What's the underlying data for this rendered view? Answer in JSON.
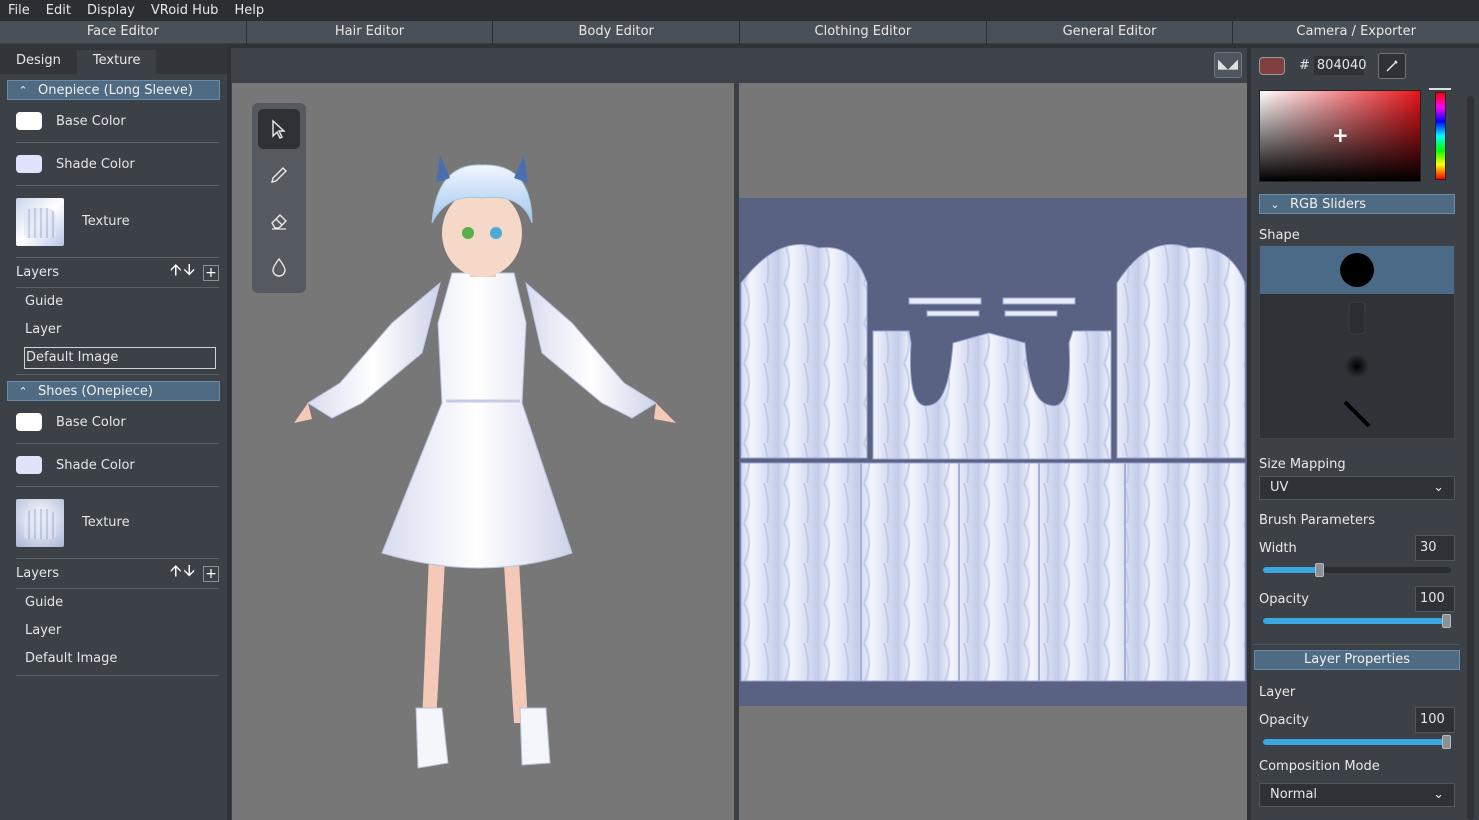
{
  "menu": [
    "File",
    "Edit",
    "Display",
    "VRoid Hub",
    "Help"
  ],
  "editor_tabs": [
    "Face Editor",
    "Hair Editor",
    "Body Editor",
    "Clothing Editor",
    "General Editor",
    "Camera / Exporter"
  ],
  "left": {
    "subtabs": [
      "Design",
      "Texture"
    ],
    "active_subtab": "Texture",
    "sections": [
      {
        "title": "Onepiece (Long Sleeve)",
        "base_color_label": "Base Color",
        "shade_color_label": "Shade Color",
        "texture_label": "Texture",
        "layers_label": "Layers",
        "layers": [
          "Guide",
          "Layer",
          "Default Image"
        ],
        "selected_layer": "Default Image"
      },
      {
        "title": "Shoes (Onepiece)",
        "base_color_label": "Base Color",
        "shade_color_label": "Shade Color",
        "texture_label": "Texture",
        "layers_label": "Layers",
        "layers": [
          "Guide",
          "Layer",
          "Default Image"
        ]
      }
    ],
    "colors": {
      "base": "#ffffff",
      "shade": "#dfe3fb"
    }
  },
  "tools": [
    "pointer-icon",
    "pencil-icon",
    "eraser-icon",
    "bucket-icon"
  ],
  "right": {
    "current_color": "#804040",
    "hex_prefix": "#",
    "hex_value": "804040",
    "rgb_sliders_label": "RGB Sliders",
    "shape_label": "Shape",
    "shapes": [
      "hard-round",
      "texture-brush",
      "soft-round",
      "line"
    ],
    "size_mapping_label": "Size Mapping",
    "size_mapping_value": "UV",
    "brush_parameters_label": "Brush Parameters",
    "width_label": "Width",
    "width_value": "30",
    "width_level": 0.3,
    "opacity_label": "Opacity",
    "opacity_value": "100",
    "opacity_level": 1.0,
    "layer_properties_label": "Layer Properties",
    "layer_label": "Layer",
    "layer_opacity_label": "Opacity",
    "layer_opacity_value": "100",
    "layer_opacity_level": 1.0,
    "composition_mode_label": "Composition Mode",
    "composition_mode_value": "Normal"
  }
}
